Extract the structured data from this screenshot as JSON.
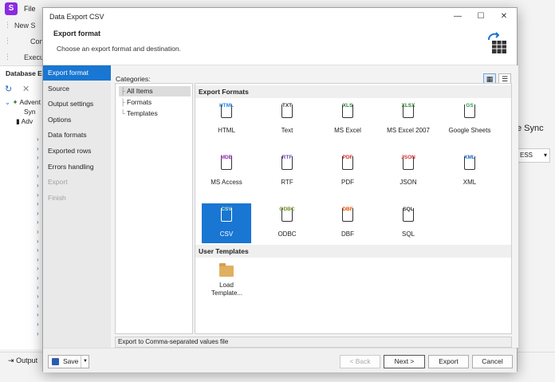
{
  "app": {
    "logo_letter": "S",
    "menu_file": "File",
    "toolbar_new": "New S",
    "toolbar_con": "Con",
    "toolbar_exec": "Execu",
    "db_explorer_title": "Database Ex",
    "tree_root": "Advent",
    "tree_sync": "Syn",
    "tree_adv": "Adv",
    "right_header": "e Sync",
    "right_combo": "ESS",
    "output_label": "Output"
  },
  "dialog": {
    "title": "Data Export CSV",
    "header_title": "Export format",
    "header_subtitle": "Choose an export format and destination.",
    "nav": [
      {
        "label": "Export format",
        "state": "active"
      },
      {
        "label": "Source",
        "state": "normal"
      },
      {
        "label": "Output settings",
        "state": "normal"
      },
      {
        "label": "Options",
        "state": "normal"
      },
      {
        "label": "Data formats",
        "state": "normal"
      },
      {
        "label": "Exported rows",
        "state": "normal"
      },
      {
        "label": "Errors handling",
        "state": "normal"
      },
      {
        "label": "Export",
        "state": "disabled"
      },
      {
        "label": "Finish",
        "state": "disabled"
      }
    ],
    "categories_label": "Categories:",
    "categories": [
      "All Items",
      "Formats",
      "Templates"
    ],
    "groups": {
      "export_formats": "Export Formats",
      "user_templates": "User Templates"
    },
    "formats": [
      {
        "tag": "HTML",
        "label": "HTML",
        "color": "#1e88e5"
      },
      {
        "tag": "TXT",
        "label": "Text",
        "color": "#333333"
      },
      {
        "tag": "XLS",
        "label": "MS Excel",
        "color": "#2e7d32"
      },
      {
        "tag": "XLSX",
        "label": "MS Excel 2007",
        "color": "#2e7d32"
      },
      {
        "tag": "GS",
        "label": "Google Sheets",
        "color": "#2e9d4f"
      },
      {
        "tag": "MDB",
        "label": "MS Access",
        "color": "#8e24aa"
      },
      {
        "tag": "RTF",
        "label": "RTF",
        "color": "#6a3fb5"
      },
      {
        "tag": "PDF",
        "label": "PDF",
        "color": "#d32f2f"
      },
      {
        "tag": "JSON",
        "label": "JSON",
        "color": "#d32f2f"
      },
      {
        "tag": "XML",
        "label": "XML",
        "color": "#1565c0"
      },
      {
        "tag": "CSV",
        "label": "CSV",
        "color": "#a5d6a7"
      },
      {
        "tag": "ODBC",
        "label": "ODBC",
        "color": "#6b8e23"
      },
      {
        "tag": "DBF",
        "label": "DBF",
        "color": "#e65100"
      },
      {
        "tag": "SQL",
        "label": "SQL",
        "color": "#333333"
      }
    ],
    "selected_format": "CSV",
    "template_tile_label": "Load Template...",
    "description": "Export to Comma-separated values file",
    "buttons": {
      "save": "Save",
      "back": "< Back",
      "next": "Next >",
      "export": "Export",
      "cancel": "Cancel"
    },
    "accent_color": "#1976d2"
  }
}
